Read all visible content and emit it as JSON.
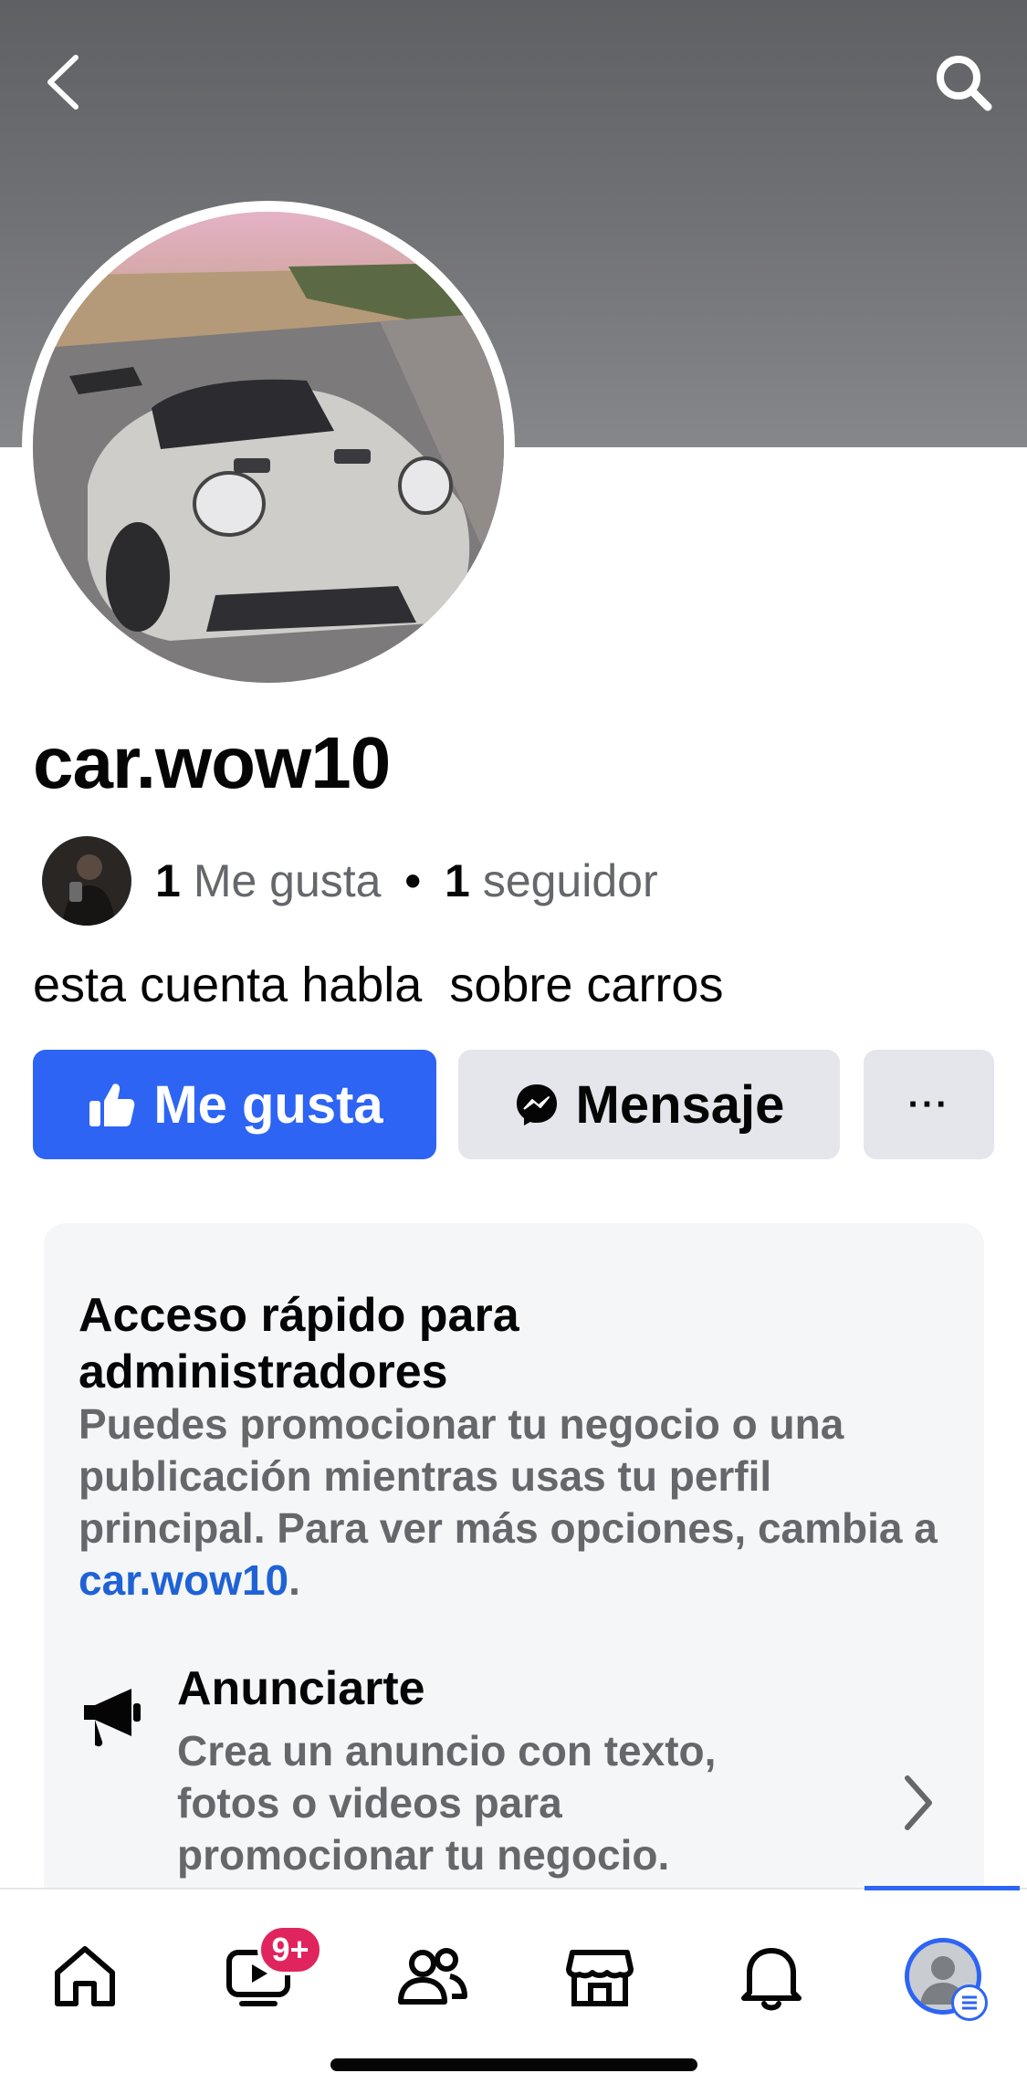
{
  "page": {
    "name": "car.wow10",
    "bio": "esta cuenta habla  sobre carros"
  },
  "stats": {
    "likes_count": "1",
    "likes_label": "Me gusta",
    "separator": "•",
    "followers_count": "1",
    "followers_label": "seguidor"
  },
  "actions": {
    "like_label": "Me gusta",
    "message_label": "Mensaje",
    "more_label": "···"
  },
  "admin_card": {
    "title": "Acceso rápido para administradores",
    "desc_prefix": "Puedes promocionar tu negocio o una publicación mientras usas tu perfil principal. Para ver más opciones, cambia a ",
    "desc_link": "car.wow10",
    "desc_suffix": ".",
    "promo_title": "Anunciarte",
    "promo_desc": "Crea un anuncio con texto, fotos o videos para promocionar tu negocio."
  },
  "tabbar": {
    "items": [
      {
        "name": "home",
        "icon": "home-icon"
      },
      {
        "name": "video",
        "icon": "video-icon",
        "badge": "9+"
      },
      {
        "name": "friends",
        "icon": "friends-icon"
      },
      {
        "name": "marketplace",
        "icon": "marketplace-icon"
      },
      {
        "name": "notifications",
        "icon": "bell-icon"
      },
      {
        "name": "profile",
        "icon": "profile-avatar-icon",
        "active": true
      }
    ]
  },
  "colors": {
    "accent": "#2d64f4",
    "badge": "#e0245e",
    "link": "#1f62d6",
    "muted_text": "#65676b",
    "secondary_button": "#e4e6eb"
  }
}
